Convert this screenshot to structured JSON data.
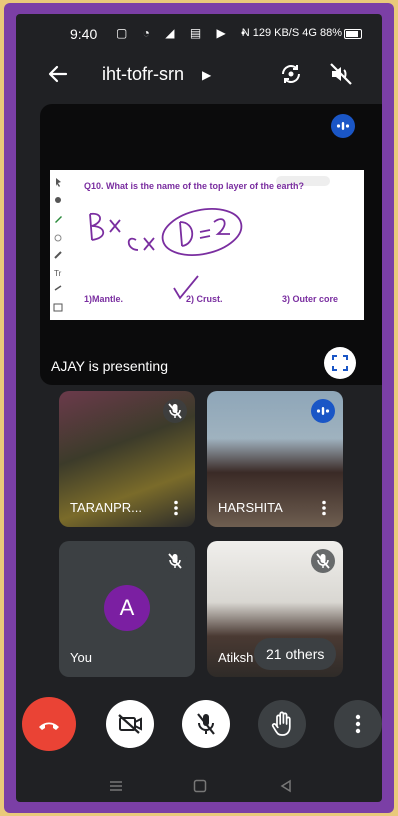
{
  "status_bar": {
    "time": "9:40",
    "icons": "▢ ◔ ◢ ▤ ▶ •",
    "right": "N 129 KB/S 4G 88%"
  },
  "meeting": {
    "code": "iht-tofr-srn"
  },
  "presentation": {
    "presenter_text": "AJAY is presenting",
    "slide": {
      "question": "Q10. What is the name of the top layer of the earth?",
      "option_1": "1)Mantle.",
      "option_2": "2) Crust.",
      "option_3": "3) Outer core",
      "ink_annotations": "B× c× D=2 ✓"
    }
  },
  "participants": [
    {
      "name": "TARANPR...",
      "muted": true,
      "speaking": false
    },
    {
      "name": "HARSHITA",
      "muted": false,
      "speaking": true
    },
    {
      "name": "You",
      "muted": true,
      "avatar_letter": "A",
      "avatar_color": "#7b1fa2"
    },
    {
      "name": "Atiksh",
      "muted": true
    }
  ],
  "others_label": "21 others",
  "controls": {
    "end_call_color": "#ea4335",
    "items": [
      "end-call",
      "camera-off",
      "mic-off",
      "raise-hand",
      "more-options"
    ]
  },
  "colors": {
    "background": "#202124",
    "accent_blue": "#1a56c6",
    "tile_gray": "#3c4043",
    "outer_frame": "#7b3fa6",
    "outer_border": "#e9c97a"
  }
}
